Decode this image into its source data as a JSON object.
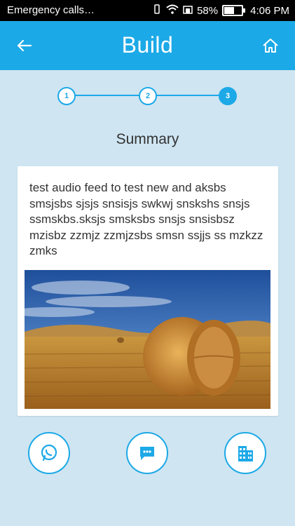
{
  "statusbar": {
    "notification": "Emergency calls…",
    "battery": "58%",
    "time": "4:06 PM"
  },
  "appbar": {
    "title": "Build"
  },
  "stepper": {
    "steps": [
      "1",
      "2",
      "3"
    ],
    "active": 3
  },
  "summary": {
    "title": "Summary",
    "text": "test audio feed to test new and aksbs smsjsbs sjsjs snsisjs swkwj snskshs snsjs ssmskbs.sksjs smsksbs snsjs snsisbsz mzisbz zzmjz zzmjzsbs smsn ssjjs ss mzkzz zmks"
  },
  "colors": {
    "accent": "#1ca9e7",
    "background": "#cfe5f2"
  },
  "icons": {
    "back": "arrow-left-icon",
    "home": "home-icon",
    "share1": "whatsapp-icon",
    "share2": "message-icon",
    "share3": "building-icon"
  }
}
